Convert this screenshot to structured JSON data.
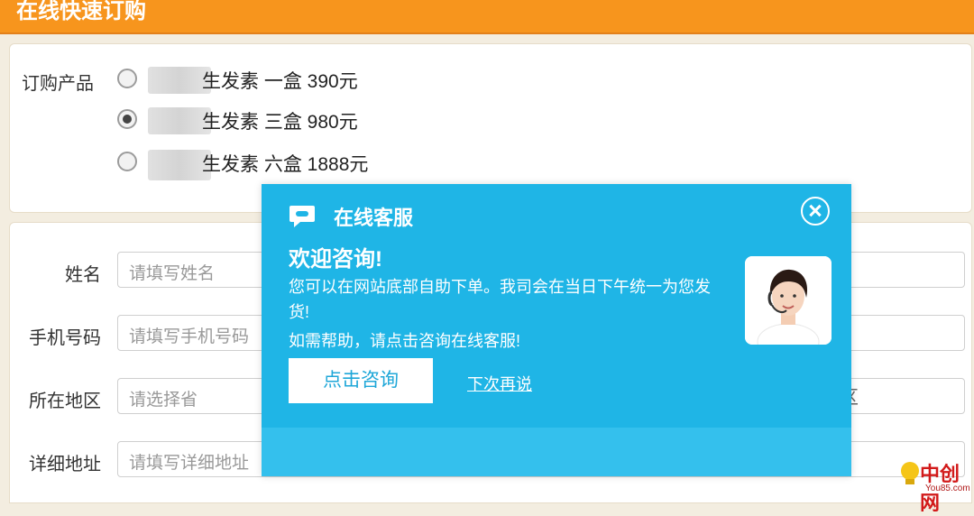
{
  "header": {
    "title": "在线快速订购"
  },
  "order": {
    "label": "订购产品",
    "options": [
      {
        "text": "生发素 一盒 390元",
        "checked": false
      },
      {
        "text": "生发素 三盒 980元",
        "checked": true
      },
      {
        "text": "生发素 六盒 1888元",
        "checked": false
      }
    ]
  },
  "form": {
    "name": {
      "label": "姓名",
      "placeholder": "请填写姓名"
    },
    "phone": {
      "label": "手机号码",
      "placeholder": "请填写手机号码"
    },
    "region": {
      "label": "所在地区",
      "province_placeholder": "请选择省",
      "district_placeholder": "区"
    },
    "address": {
      "label": "详细地址",
      "placeholder": "请填写详细地址"
    }
  },
  "popup": {
    "title": "在线客服",
    "heading": "欢迎咨询!",
    "message": "您可以在网站底部自助下单。我司会在当日下午统一为您发货!",
    "help": "如需帮助，请点击咨询在线客服!",
    "consult_button": "点击咨询",
    "later_link": "下次再说",
    "icon": "chat-bubble-icon",
    "close_icon": "close-icon"
  },
  "watermark": {
    "text": "中创网",
    "sub": "You85.com"
  },
  "colors": {
    "header": "#f7951d",
    "popup_bg": "#1fb5e6",
    "popup_footer": "#34c0ed",
    "button_text": "#1fa7d8"
  }
}
